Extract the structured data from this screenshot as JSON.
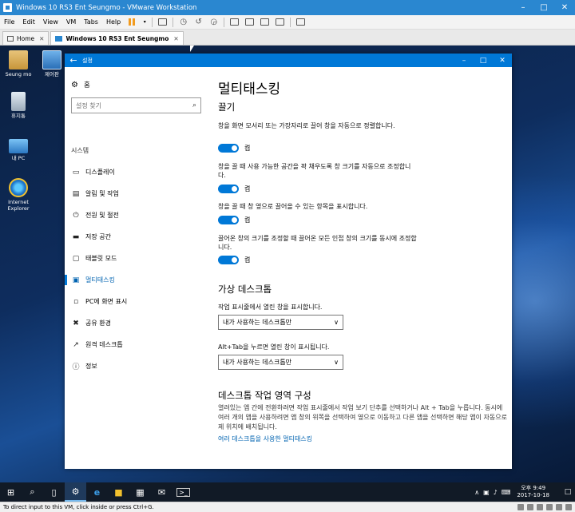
{
  "vmware": {
    "title": "Windows 10 RS3 Ent Seungmo - VMware Workstation",
    "menu": [
      "File",
      "Edit",
      "View",
      "VM",
      "Tabs",
      "Help"
    ],
    "tabs": [
      {
        "label": "Home",
        "active": false
      },
      {
        "label": "Windows 10 RS3 Ent Seungmo",
        "active": true
      }
    ],
    "status_text": "To direct input to this VM, click inside or press Ctrl+G."
  },
  "desktop": {
    "icons": [
      {
        "label": "Seung mo",
        "icon": "user-folder-icon"
      },
      {
        "label": "제어판",
        "icon": "control-panel-icon"
      },
      {
        "label": "휴지통",
        "icon": "recycle-bin-icon"
      },
      {
        "label": "내 PC",
        "icon": "this-pc-icon"
      },
      {
        "label": "Internet Explorer",
        "icon": "internet-explorer-icon"
      }
    ]
  },
  "settings": {
    "window_title": "설정",
    "nav": {
      "home_label": "홈",
      "search_placeholder": "설정 찾기",
      "section_label": "시스템",
      "items": [
        {
          "label": "디스플레이",
          "icon": "display-icon",
          "active": false
        },
        {
          "label": "알림 및 작업",
          "icon": "notifications-icon",
          "active": false
        },
        {
          "label": "전원 및 절전",
          "icon": "power-icon",
          "active": false
        },
        {
          "label": "저장 공간",
          "icon": "storage-icon",
          "active": false
        },
        {
          "label": "태블릿 모드",
          "icon": "tablet-mode-icon",
          "active": false
        },
        {
          "label": "멀티태스킹",
          "icon": "multitasking-icon",
          "active": true
        },
        {
          "label": "PC에 화면 표시",
          "icon": "project-icon",
          "active": false
        },
        {
          "label": "공유 환경",
          "icon": "shared-experiences-icon",
          "active": false
        },
        {
          "label": "원격 데스크톱",
          "icon": "remote-desktop-icon",
          "active": false
        },
        {
          "label": "정보",
          "icon": "info-icon",
          "active": false
        }
      ]
    },
    "content": {
      "page_title": "멀티태스킹",
      "snap_heading": "끌기",
      "snap_options": [
        {
          "text": "창을 화면 모서리 또는 가장자리로 끌어 창을 자동으로 정렬합니다.",
          "state": "켬"
        },
        {
          "text": "창을 끌 때 사용 가능한 공간을 꽉 채우도록 창 크기를 자동으로 조정합니다.",
          "state": "켬"
        },
        {
          "text": "창을 끌 때 창 옆으로 끌어올 수 있는 항목을 표시합니다.",
          "state": "켬"
        },
        {
          "text": "끌어온 창의 크기를 조정할 때 끌어온 모든 인접 창의 크기를 동시에 조정합니다.",
          "state": "켬"
        }
      ],
      "vd_heading": "가상 데스크톱",
      "vd_taskbar_label": "작업 표시줄에서 열린 창을 표시합니다.",
      "vd_taskbar_value": "내가 사용하는 데스크톱만",
      "vd_alttab_label": "Alt+Tab을 누르면 열린 창이 표시됩니다.",
      "vd_alttab_value": "내가 사용하는 데스크톱만",
      "config_heading": "데스크톱 작업 영역 구성",
      "config_text": "열려있는 앱 간에 전환하려면 작업 표시줄에서 작업 보기 단추를 선택하거나 Alt + Tab을 누릅니다. 동시에 여러 개의 앱을 사용하려면 앱 창의 위쪽을 선택하여 옆으로 이동하고 다른 앱을 선택하면 해당 앱이 자동으로 제 위치에 배치됩니다.",
      "config_link": "여러 데스크톱을 사용한 멀티태스킹"
    }
  },
  "taskbar": {
    "time": "오후 9:49",
    "date": "2017-10-18"
  }
}
